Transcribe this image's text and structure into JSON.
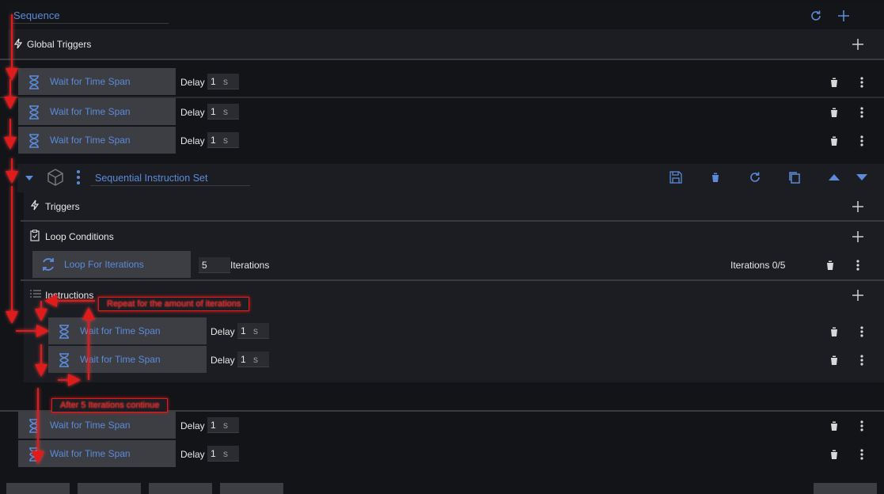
{
  "header": {
    "title": "Sequence"
  },
  "global_triggers": {
    "label": "Global Triggers"
  },
  "wait_item_label": "Wait for Time Span",
  "delay_label": "Delay",
  "delay_value": "1",
  "delay_unit": "s",
  "instruction_set": {
    "title": "Sequential Instruction Set",
    "triggers_label": "Triggers",
    "loop_conditions_label": "Loop Conditions",
    "loop": {
      "name": "Loop For Iterations",
      "value": "5",
      "unit": "Iterations",
      "status": "Iterations 0/5"
    },
    "instructions_label": "Instructions"
  },
  "annotations": {
    "repeat": "Repeat for the amount of iterations",
    "continue": "After 5 Iterations continue"
  },
  "colors": {
    "accent": "#5b8bd9",
    "annotation": "#e01b1b",
    "background": "#131418"
  }
}
